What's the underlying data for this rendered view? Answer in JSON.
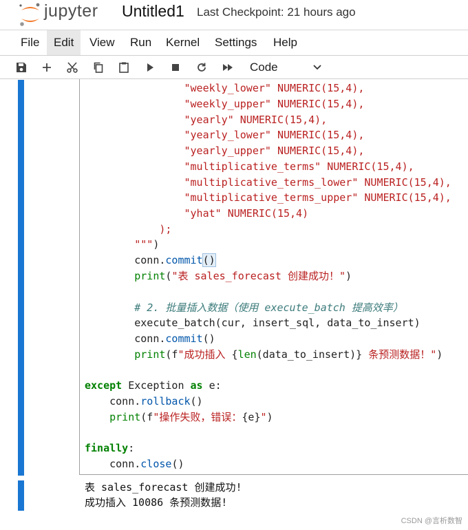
{
  "header": {
    "logo_text": "jupyter",
    "notebook_title": "Untitled1",
    "checkpoint": "Last Checkpoint: 21 hours ago"
  },
  "menu": {
    "items": [
      "File",
      "Edit",
      "View",
      "Run",
      "Kernel",
      "Settings",
      "Help"
    ],
    "active": "Edit"
  },
  "toolbar": {
    "buttons": [
      "save-icon",
      "add-cell-icon",
      "cut-icon",
      "copy-icon",
      "paste-icon",
      "run-icon",
      "stop-icon",
      "restart-icon",
      "fast-forward-icon"
    ],
    "cell_type": "Code"
  },
  "code_lines": [
    [
      "                \"weekly_lower\" NUMERIC(15,4),"
    ],
    [
      "                \"weekly_upper\" NUMERIC(15,4),"
    ],
    [
      "                \"yearly\" NUMERIC(15,4),"
    ],
    [
      "                \"yearly_lower\" NUMERIC(15,4),"
    ],
    [
      "                \"yearly_upper\" NUMERIC(15,4),"
    ],
    [
      "                \"multiplicative_terms\" NUMERIC(15,4),"
    ],
    [
      "                \"multiplicative_terms_lower\" NUMERIC(15,4),"
    ],
    [
      "                \"multiplicative_terms_upper\" NUMERIC(15,4),"
    ],
    [
      "                \"yhat\" NUMERIC(15,4)"
    ],
    [
      "            );"
    ],
    [
      "        \"\"\")"
    ],
    [
      "        conn.commit()"
    ],
    [
      "        print(\"表 sales_forecast 创建成功！\")"
    ],
    [
      ""
    ],
    [
      "        # 2. 批量插入数据（使用 execute_batch 提高效率）"
    ],
    [
      "        execute_batch(cur, insert_sql, data_to_insert)"
    ],
    [
      "        conn.commit()"
    ],
    [
      "        print(f\"成功插入 {len(data_to_insert)} 条预测数据！\")"
    ],
    [
      ""
    ],
    [
      "except Exception as e:"
    ],
    [
      "    conn.rollback()"
    ],
    [
      "    print(f\"操作失败，错误：{e}\")"
    ],
    [
      ""
    ],
    [
      "finally:"
    ],
    [
      "    conn.close()"
    ]
  ],
  "output_lines": [
    "表 sales_forecast 创建成功!",
    "成功插入 10086 条预测数据!"
  ],
  "watermark": "CSDN @言析数智",
  "colors": {
    "cell_bar": "#1976d2",
    "string": "#ba2121",
    "keyword": "#008000",
    "comment": "#3d7b7b",
    "method": "#0055aa"
  }
}
